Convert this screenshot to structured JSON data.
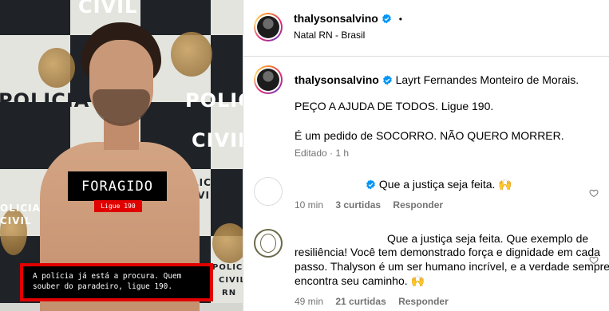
{
  "media": {
    "wall_words": [
      "CIVIL",
      "POLICIA",
      "CIVIL",
      "POLICIA",
      "CIVIL",
      "POLICIA",
      "CIVIL",
      "OLICIA",
      "CIVIL",
      "POLICIA",
      "CIVIL",
      "RN"
    ],
    "foragido_label": "FORAGIDO",
    "ligue_label": "Ligue 190",
    "alert_line1": "A polícia já está a procura. Quem",
    "alert_line2": "souber do paradeiro, ligue 190."
  },
  "header": {
    "username": "thalysonsalvino",
    "dot": "•",
    "location": "Natal RN - Brasil"
  },
  "caption": {
    "username": "thalysonsalvino",
    "name_line": "Layrt Fernandes Monteiro de Morais.",
    "line1": "PEÇO A AJUDA DE TODOS. Ligue 190.",
    "line2": "É um pedido de SOCORRO. NÃO QUERO MORRER.",
    "edited": "Editado",
    "dot": "·",
    "time": "1 h"
  },
  "comments": [
    {
      "text": "Que a justiça seja feita. 🙌",
      "time": "10 min",
      "likes": "3 curtidas",
      "reply": "Responder"
    },
    {
      "line1": "Que a justiça seja feita. Que exemplo de",
      "line2": "resiliência! Você tem demonstrado força e dignidade em cada",
      "line3": "passo. Thalyson é um ser humano incrível, e a verdade sempre",
      "line4": "encontra seu caminho. 🙌",
      "time": "49 min",
      "likes": "21 curtidas",
      "reply": "Responder"
    }
  ],
  "colors": {
    "verified_blue": "#0095f6",
    "alert_red": "#e00000",
    "meta_gray": "#737373"
  }
}
